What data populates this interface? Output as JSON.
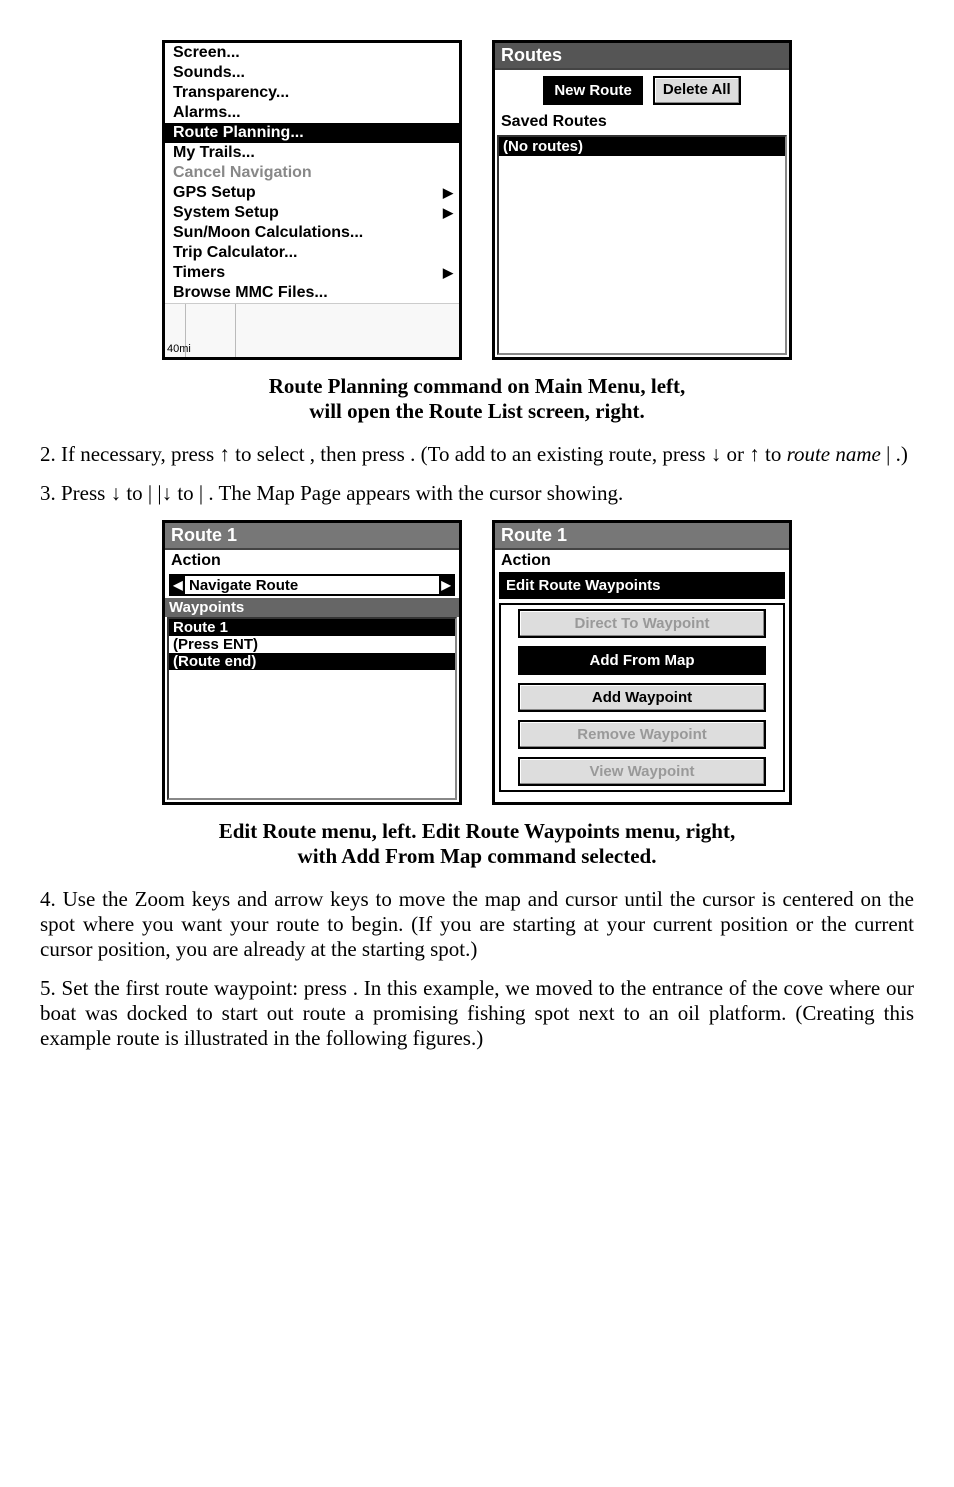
{
  "menuLeft": [
    "Screen...",
    "Sounds...",
    "Transparency...",
    "Alarms...",
    "Route Planning...",
    "My Trails...",
    "Cancel Navigation",
    "GPS Setup",
    "System Setup",
    "Sun/Moon Calculations...",
    "Trip Calculator...",
    "Timers",
    "Browse MMC Files..."
  ],
  "mapScale": "40mi",
  "routesTitle": "Routes",
  "newRouteBtn": "New Route",
  "deleteAllBtn": "Delete All",
  "savedRoutesLbl": "Saved Routes",
  "noRoutes": "(No routes)",
  "cap1a": "Route Planning command on Main Menu, left,",
  "cap1b": "will open the Route List screen, right.",
  "step2": "2. If necessary, press ↑ to select               , then press      . (To add to an existing route, press ↓  or ↑ to ",
  "step2i": "route name",
  "step2end": " |      .)",
  "step3": "3.  Press ↓ to                |      |↓ to                      |      . The Map Page appears with the cursor showing.",
  "r1Title": "Route 1",
  "actionLbl": "Action",
  "navRoute": "Navigate Route",
  "wpHeader": "Waypoints",
  "wpRows": [
    "Route 1",
    "(Press ENT)",
    "(Route end)"
  ],
  "editWpTitle": "Edit Route Waypoints",
  "editBtns": [
    "Direct To Waypoint",
    "Add From Map",
    "Add Waypoint",
    "Remove Waypoint",
    "View Waypoint"
  ],
  "cap2a": "Edit Route menu, left. Edit Route Waypoints menu, right,",
  "cap2b": "with Add From Map command selected.",
  "step4": "4. Use the Zoom keys and arrow keys to move the map and cursor until the cursor is centered on the spot where you want your route to begin. (If you are starting at your current position or the current cursor position, you are already at the starting spot.)",
  "step5": "5. Set the first route waypoint: press       . In this example, we moved to the entrance of the cove where our boat was docked to start out route a promising fishing spot next to an oil platform. (Creating this example route is illustrated in the following figures.)"
}
